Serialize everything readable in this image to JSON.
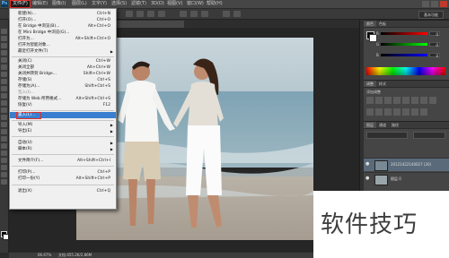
{
  "menubar": {
    "logo": "Ps",
    "items": [
      "文件(F)",
      "编辑(E)",
      "图像(I)",
      "图层(L)",
      "文字(Y)",
      "选择(S)",
      "滤镜(T)",
      "3D(D)",
      "视图(V)",
      "窗口(W)",
      "帮助(H)"
    ]
  },
  "workspace": {
    "label": "基本功能"
  },
  "document": {
    "tab_title": "图层 0, RGB/8) *",
    "zoom": "66.67%",
    "info": "文档:455.2K/2.86M"
  },
  "file_menu": {
    "items": [
      {
        "label": "新建(N)...",
        "shortcut": "Ctrl+N"
      },
      {
        "label": "打开(O)...",
        "shortcut": "Ctrl+O"
      },
      {
        "label": "在 Bridge 中浏览(B)...",
        "shortcut": "Alt+Ctrl+O"
      },
      {
        "label": "在 Mini Bridge 中浏览(G)...",
        "shortcut": ""
      },
      {
        "label": "打开为...",
        "shortcut": "Alt+Shift+Ctrl+O"
      },
      {
        "label": "打开为智能对象...",
        "shortcut": ""
      },
      {
        "label": "最近打开文件(T)",
        "shortcut": "",
        "submenu": true
      },
      {
        "label": "关闭(C)",
        "shortcut": "Ctrl+W"
      },
      {
        "label": "关闭全部",
        "shortcut": "Alt+Ctrl+W"
      },
      {
        "label": "关闭并转到 Bridge...",
        "shortcut": "Shift+Ctrl+W"
      },
      {
        "label": "存储(S)",
        "shortcut": "Ctrl+S"
      },
      {
        "label": "存储为(A)...",
        "shortcut": "Shift+Ctrl+S"
      },
      {
        "label": "签入(I)...",
        "shortcut": "",
        "disabled": true
      },
      {
        "label": "存储为 Web 所用格式...",
        "shortcut": "Alt+Shift+Ctrl+S"
      },
      {
        "label": "恢复(V)",
        "shortcut": "F12"
      },
      {
        "label": "置入(L)...",
        "shortcut": "",
        "highlight": true
      },
      {
        "label": "导入(M)",
        "shortcut": "",
        "submenu": true
      },
      {
        "label": "导出(E)",
        "shortcut": "",
        "submenu": true
      },
      {
        "label": "自动(U)",
        "shortcut": "",
        "submenu": true
      },
      {
        "label": "脚本(R)",
        "shortcut": "",
        "submenu": true
      },
      {
        "label": "文件简介(F)...",
        "shortcut": "Alt+Shift+Ctrl+I"
      },
      {
        "label": "打印(P)...",
        "shortcut": "Ctrl+P"
      },
      {
        "label": "打印一份(Y)",
        "shortcut": "Alt+Shift+Ctrl+P"
      },
      {
        "label": "退出(X)",
        "shortcut": "Ctrl+Q"
      }
    ]
  },
  "color_panel": {
    "tabs": [
      "颜色",
      "色板"
    ],
    "channels": [
      {
        "label": "R",
        "value": "0"
      },
      {
        "label": "G",
        "value": "0"
      },
      {
        "label": "B",
        "value": "0"
      }
    ]
  },
  "adjustments_panel": {
    "tabs": [
      "调整",
      "样式"
    ],
    "hint": "添加调整"
  },
  "layers_panel": {
    "tabs": [
      "图层",
      "通道",
      "路径"
    ],
    "layers": [
      {
        "name": "20121422140027 (20)",
        "selected": true
      },
      {
        "name": "图层 0",
        "selected": false
      }
    ]
  },
  "watermark": {
    "text": "软件技巧"
  }
}
